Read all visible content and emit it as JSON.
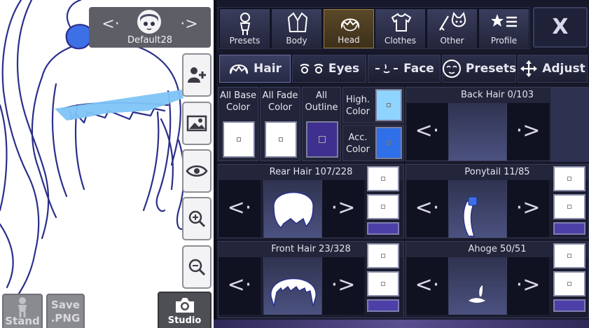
{
  "character": {
    "name": "Default28"
  },
  "left_toolbar": {
    "stand_label": "Stand",
    "save_label_line1": "Save",
    "save_label_line2": ".PNG",
    "studio_label": "Studio"
  },
  "categories": [
    {
      "label": "Presets",
      "icon": "presets-person-icon"
    },
    {
      "label": "Body",
      "icon": "jacket-icon"
    },
    {
      "label": "Head",
      "icon": "hair-head-icon",
      "active": true
    },
    {
      "label": "Clothes",
      "icon": "shirt-icon"
    },
    {
      "label": "Other",
      "icon": "sword-cat-icon"
    },
    {
      "label": "Profile",
      "icon": "star-list-icon"
    }
  ],
  "close_label": "X",
  "subtabs": [
    {
      "label": "Hair",
      "icon": "hair-icon",
      "active": true
    },
    {
      "label": "Eyes",
      "icon": "eyes-icon"
    },
    {
      "label": "Face",
      "icon": "face-icon"
    },
    {
      "label": "Presets",
      "icon": "face-preset-icon"
    },
    {
      "label": "Adjust",
      "icon": "move-arrows-icon"
    }
  ],
  "colors": {
    "all_base": {
      "line1": "All Base",
      "line2": "Color",
      "value": "#ffffff"
    },
    "all_fade": {
      "line1": "All Fade",
      "line2": "Color",
      "value": "#ffffff"
    },
    "all_outline": {
      "line1": "All",
      "line2": "Outline",
      "value": "#3f2f8e"
    },
    "highlight": {
      "line1": "High.",
      "line2": "Color",
      "value": "#8fd3ff"
    },
    "accessory": {
      "line1": "Acc.",
      "line2": "Color",
      "value": "#2f6fe8"
    }
  },
  "parts": {
    "back_hair": {
      "title": "Back Hair 0/103"
    },
    "rear_hair": {
      "title": "Rear Hair 107/228"
    },
    "ponytail": {
      "title": "Ponytail 11/85"
    },
    "front_hair": {
      "title": "Front Hair 23/328"
    },
    "ahoge": {
      "title": "Ahoge 50/51"
    }
  },
  "nav": {
    "prev": "<·",
    "next": "·>"
  }
}
